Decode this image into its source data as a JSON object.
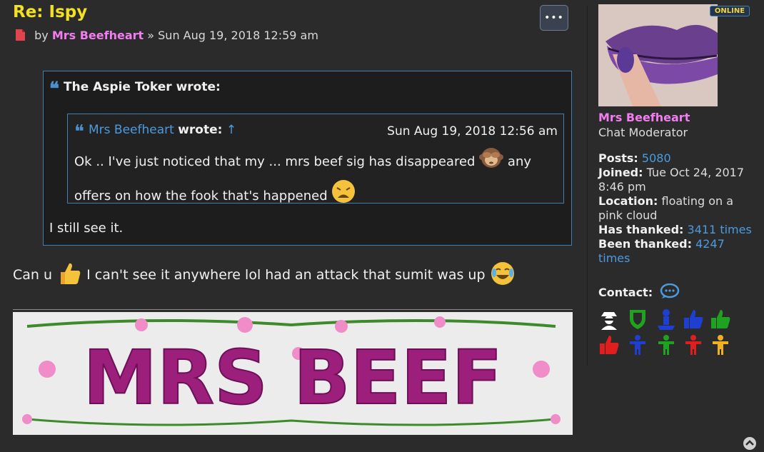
{
  "post": {
    "title": "Re: Ispy",
    "meta_by": "by",
    "author": "Mrs Beefheart",
    "meta_sep": "»",
    "date": "Sun Aug 19, 2018 12:59 am",
    "menu_label": "•••"
  },
  "quote_outer": {
    "cite": "The Aspie Toker wrote:",
    "text": "I still see it."
  },
  "quote_inner": {
    "author": "Mrs Beefheart",
    "wrote": "wrote:",
    "arrow": "↑",
    "date": "Sun Aug 19, 2018 12:56 am",
    "text_1": "Ok .. I've just noticed that my ... mrs beef sig has disappeared",
    "text_2": "any",
    "text_3": "offers on how the fook that's happened"
  },
  "body": {
    "text_1": "Can u",
    "text_2": "I can't see it anywhere lol had an attack that sumit was up"
  },
  "signature": {
    "banner_text": "MRS BEEF"
  },
  "profile": {
    "online": "ONLINE",
    "name": "Mrs Beefheart",
    "rank": "Chat Moderator",
    "posts_label": "Posts:",
    "posts_value": "5080",
    "joined_label": "Joined:",
    "joined_value": "Tue Oct 24, 2017 8:46 pm",
    "location_label": "Location:",
    "location_value": "floating on a pink cloud",
    "thanked_label": "Has thanked:",
    "thanked_value": "3411 times",
    "been_thanked_label": "Been thanked:",
    "been_thanked_value": "4247 times",
    "contact_label": "Contact:"
  },
  "colors": {
    "title": "#f2e022",
    "author": "#f27df0",
    "link": "#4b9be0",
    "quote_border": "#3f7fb3",
    "background": "#2b2b2b"
  },
  "icons": {
    "file": "file-icon",
    "menu": "ellipsis-icon",
    "quote": "quote-icon",
    "contact": "chat-bubble-icon",
    "scroll_top": "chevron-up-icon",
    "badges": [
      "spy-icon",
      "green-shield-icon",
      "blue-person-icon",
      "blue-thumbs-up-icon",
      "green-thumbs-up-icon",
      "red-thumbs-up-icon",
      "blue-figure-icon",
      "green-figure-icon",
      "red-figure-icon",
      "yellow-figure-icon"
    ]
  }
}
